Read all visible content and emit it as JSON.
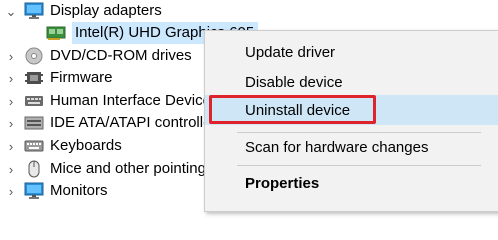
{
  "tree": {
    "display_adapters": {
      "label": "Display adapters",
      "expanded": true,
      "icon": "monitor-icon"
    },
    "selected_device": {
      "label": "Intel(R) UHD Graphics 605",
      "icon": "display-adapter-icon"
    },
    "categories": [
      {
        "label": "DVD/CD-ROM drives",
        "icon": "disc-drive-icon"
      },
      {
        "label": "Firmware",
        "icon": "firmware-icon"
      },
      {
        "label": "Human Interface Device",
        "icon": "hid-icon"
      },
      {
        "label": "IDE ATA/ATAPI controller",
        "icon": "ide-controller-icon"
      },
      {
        "label": "Keyboards",
        "icon": "keyboard-icon"
      },
      {
        "label": "Mice and other pointing",
        "icon": "mouse-icon"
      },
      {
        "label": "Monitors",
        "icon": "monitor-icon"
      }
    ]
  },
  "context_menu": {
    "items": [
      {
        "label": "Update driver"
      },
      {
        "label": "Disable device"
      },
      {
        "label": "Uninstall device",
        "hovered": true,
        "highlighted": true
      },
      {
        "label": "Scan for hardware changes"
      },
      {
        "label": "Properties",
        "bold": true
      }
    ]
  },
  "colors": {
    "selection": "#cce8ff",
    "menu_background": "#f2f2f2",
    "menu_hover": "#cfe6f7",
    "highlight_box": "#e0232a"
  }
}
